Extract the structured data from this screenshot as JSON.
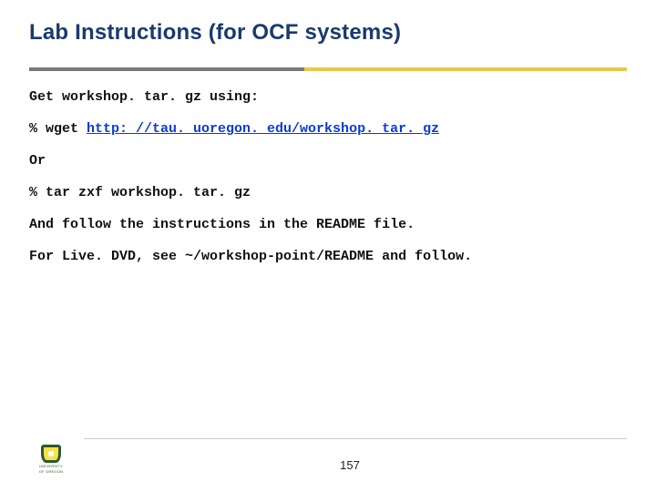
{
  "title": "Lab Instructions (for OCF systems)",
  "lines": {
    "l1": "Get workshop. tar. gz using:",
    "l2_prefix": "% wget ",
    "l2_link": "http: //tau. uoregon. edu/workshop. tar. gz",
    "l3": "Or",
    "l4": "% tar zxf workshop. tar. gz",
    "l5": "And follow the instructions in the README file.",
    "l6": "For Live. DVD, see ~/workshop-point/README and follow."
  },
  "footer": {
    "logo_top": "UNIVERSITY",
    "logo_bottom": "OF OREGON",
    "page": "157"
  }
}
